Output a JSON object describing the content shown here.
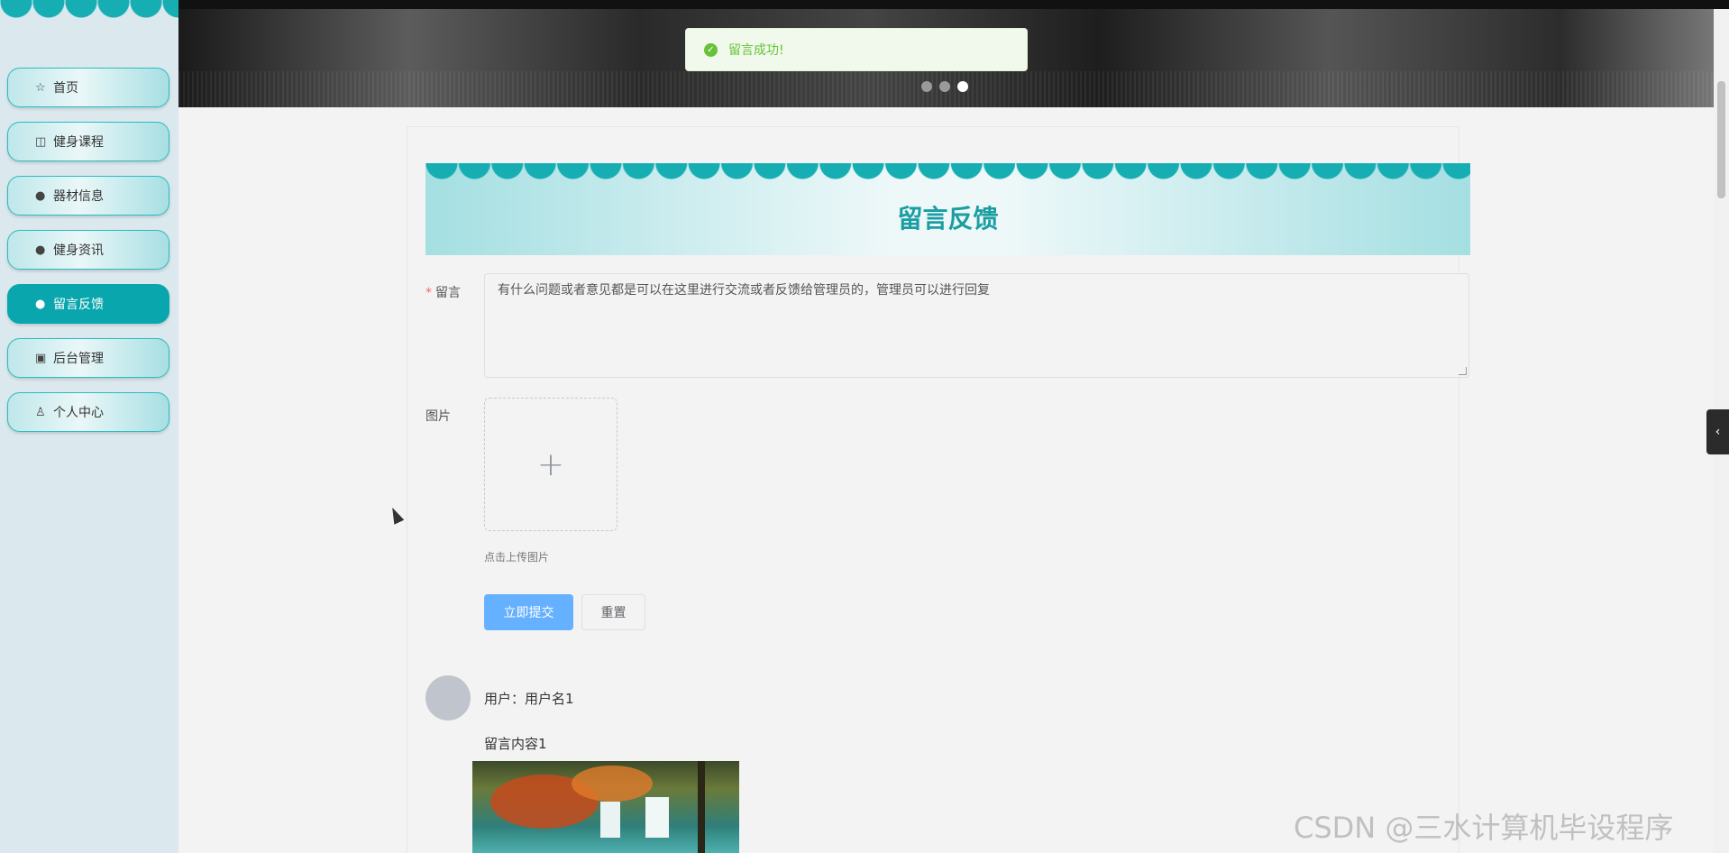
{
  "sidebar": {
    "items": [
      {
        "label": "首页",
        "icon": "star-icon"
      },
      {
        "label": "健身课程",
        "icon": "bag-icon"
      },
      {
        "label": "器材信息",
        "icon": "info-circle-icon"
      },
      {
        "label": "健身资讯",
        "icon": "question-circle-icon"
      },
      {
        "label": "留言反馈",
        "icon": "info-circle-icon",
        "active": true
      },
      {
        "label": "后台管理",
        "icon": "briefcase-icon"
      },
      {
        "label": "个人中心",
        "icon": "user-icon"
      }
    ]
  },
  "toast": {
    "message": "留言成功!",
    "type": "success"
  },
  "page": {
    "title": "留言反馈"
  },
  "form": {
    "message_label": "留言",
    "message_value": "有什么问题或者意见都是可以在这里进行交流或者反馈给管理员的，管理员可以进行回复",
    "image_label": "图片",
    "upload_tip": "点击上传图片",
    "submit_label": "立即提交",
    "reset_label": "重置"
  },
  "comment": {
    "user": "用户：用户名1",
    "content": "留言内容1"
  },
  "watermark": "CSDN @三水计算机毕设程序",
  "colors": {
    "accent": "#0aa6ad",
    "primary_button": "#66b1ff",
    "success": "#67c23a"
  }
}
